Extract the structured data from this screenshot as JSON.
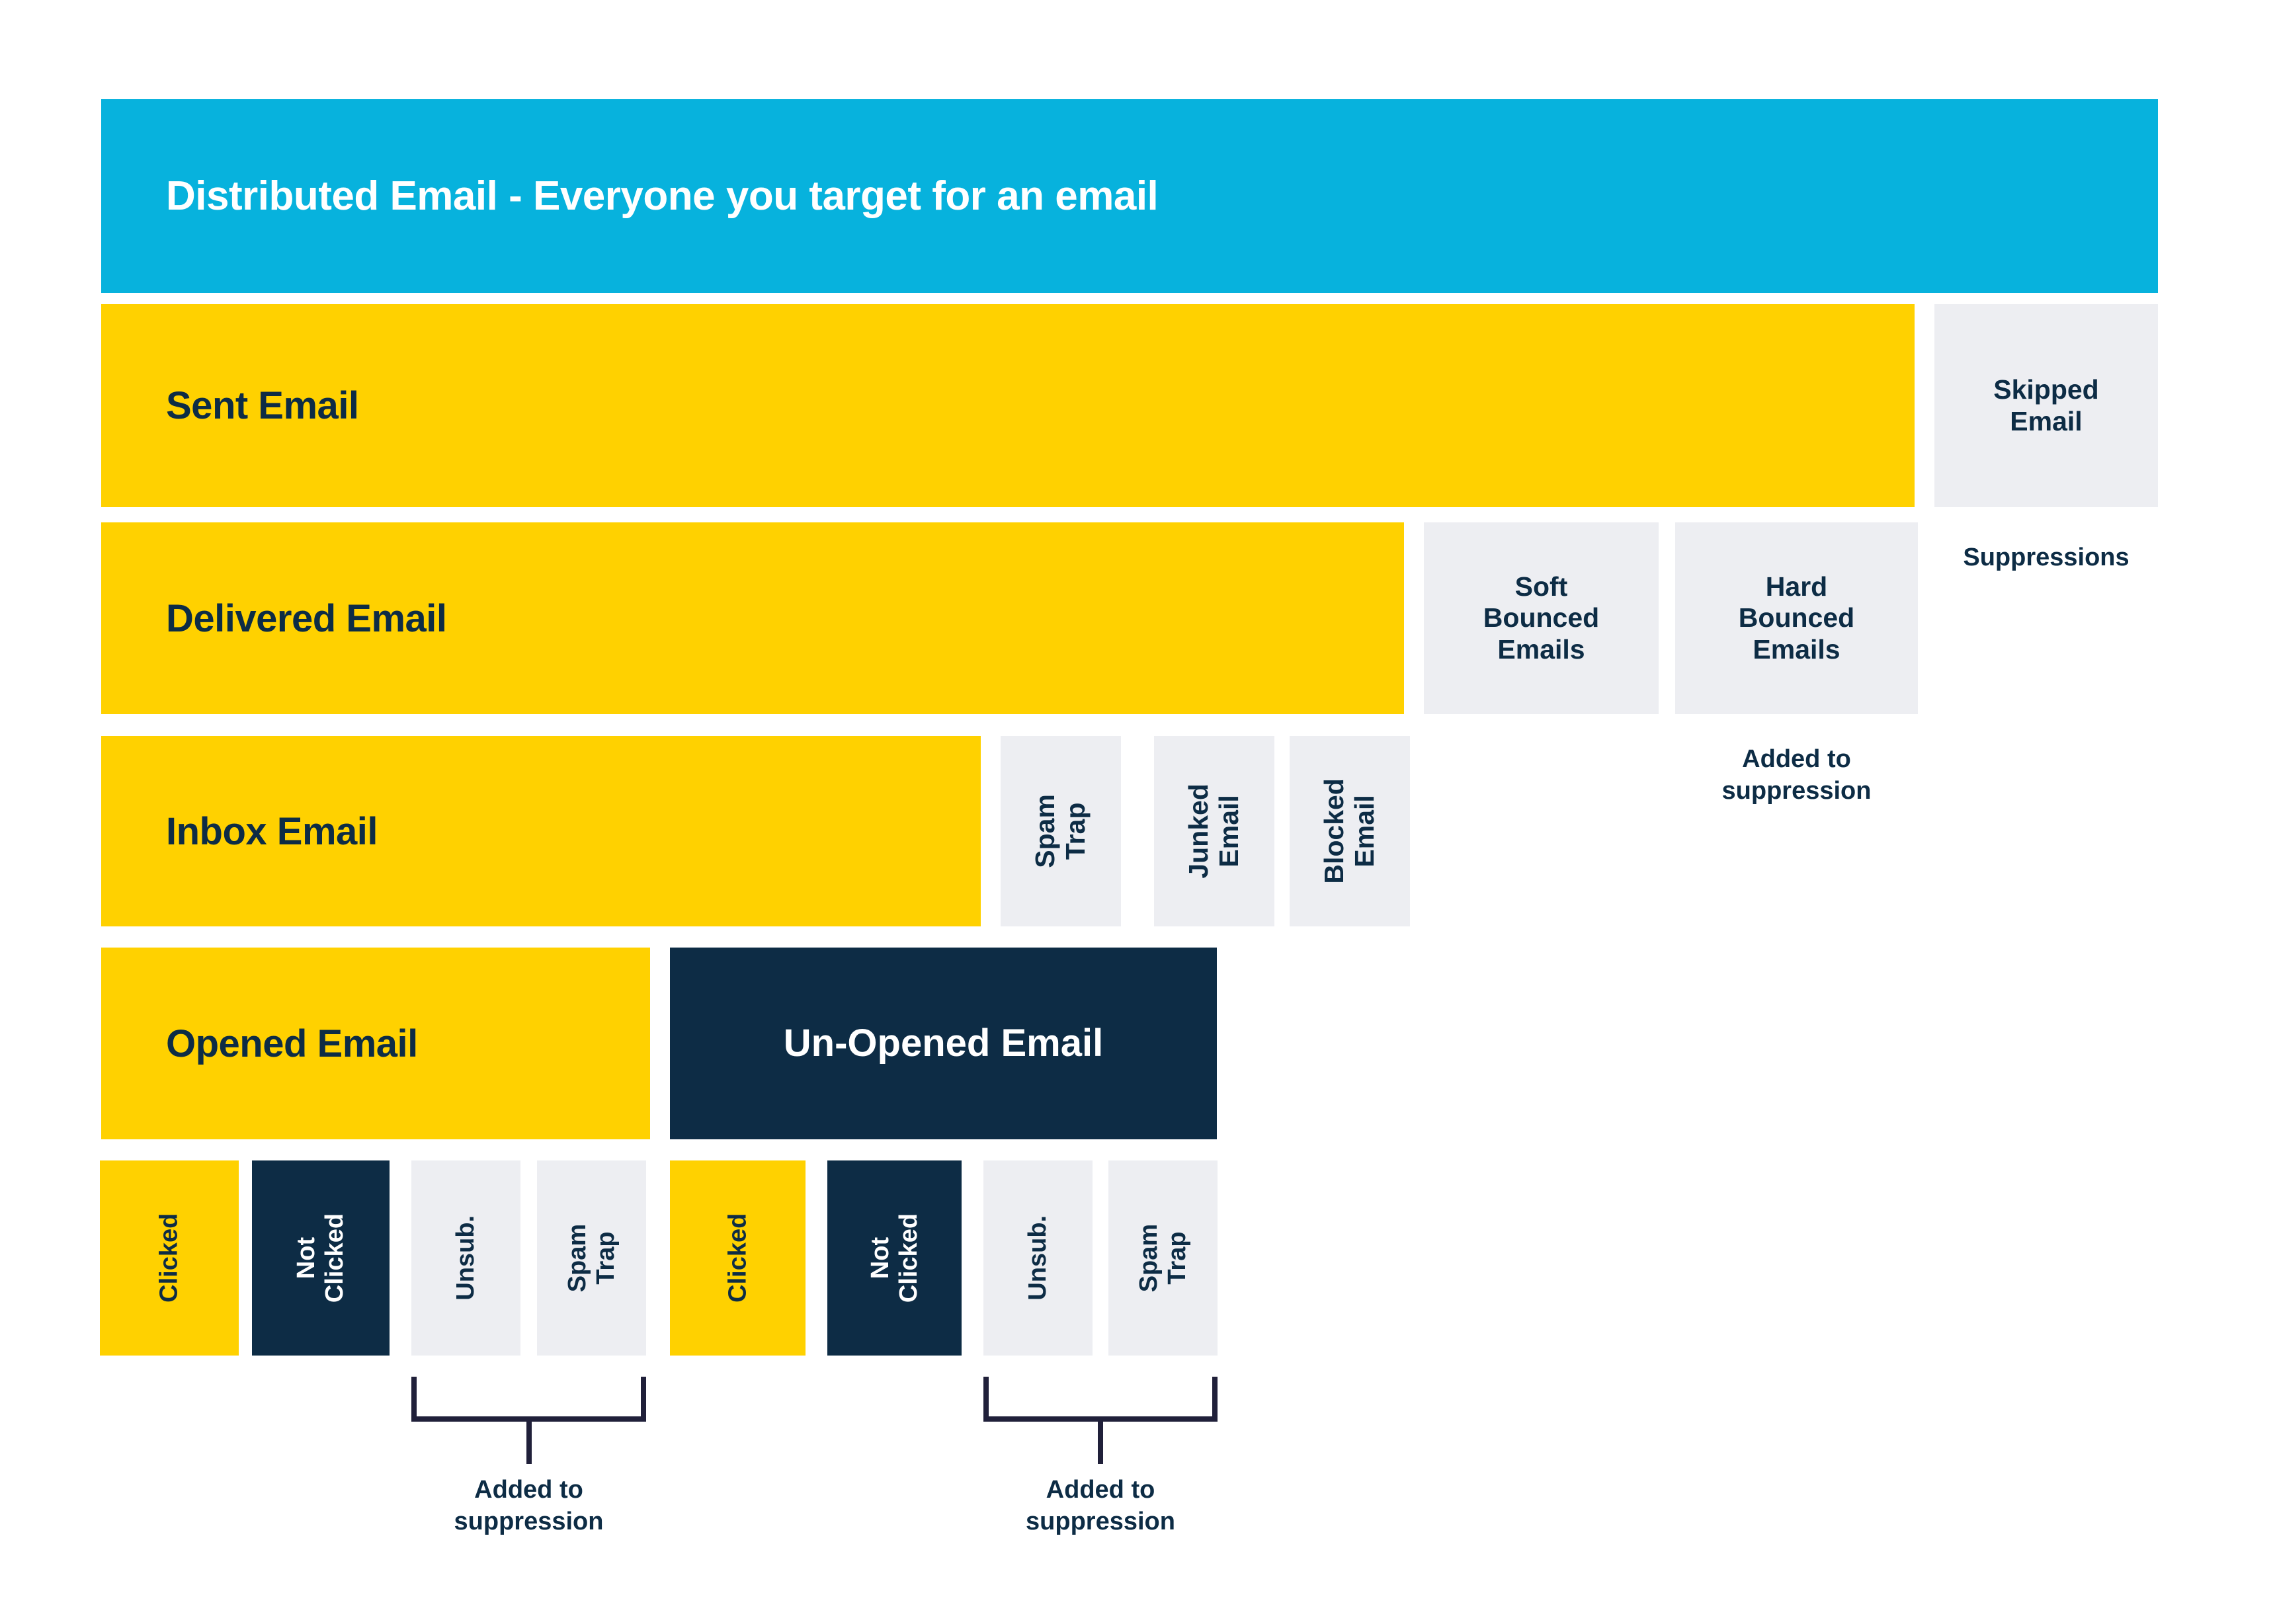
{
  "diagram": {
    "header": {
      "label": "Distributed Email - Everyone you target for an email",
      "color": "#07b2dd"
    },
    "colors": {
      "cyan": "#07b2dd",
      "yellow": "#ffd100",
      "navy": "#0d2c45",
      "gray": "#edeef2",
      "white": "#ffffff"
    },
    "rows": {
      "sent": {
        "main_label": "Sent Email",
        "side_label": "Skipped\nEmail",
        "side_label_line1": "Skipped",
        "side_label_line2": "Email",
        "caption": "Suppressions"
      },
      "delivered": {
        "main_label": "Delivered Email",
        "soft_bounce_line1": "Soft",
        "soft_bounce_line2": "Bounced",
        "soft_bounce_line3": "Emails",
        "hard_bounce_line1": "Hard",
        "hard_bounce_line2": "Bounced",
        "hard_bounce_line3": "Emails",
        "caption_line1": "Added to",
        "caption_line2": "suppression"
      },
      "inbox": {
        "main_label": "Inbox Email",
        "spam_trap_line1": "Spam",
        "spam_trap_line2": "Trap",
        "junked_line1": "Junked",
        "junked_line2": "Email",
        "blocked_line1": "Blocked",
        "blocked_line2": "Email"
      },
      "opened": {
        "opened_label": "Opened Email",
        "unopened_label": "Un-Opened Email"
      },
      "outcomes": {
        "opened_group": {
          "clicked": "Clicked",
          "not_clicked_line1": "Not",
          "not_clicked_line2": "Clicked",
          "unsub": "Unsub.",
          "spam_trap_line1": "Spam",
          "spam_trap_line2": "Trap",
          "caption_line1": "Added to",
          "caption_line2": "suppression"
        },
        "unopened_group": {
          "clicked": "Clicked",
          "not_clicked_line1": "Not",
          "not_clicked_line2": "Clicked",
          "unsub": "Unsub.",
          "spam_trap_line1": "Spam",
          "spam_trap_line2": "Trap",
          "caption_line1": "Added to",
          "caption_line2": "suppression"
        }
      }
    }
  }
}
